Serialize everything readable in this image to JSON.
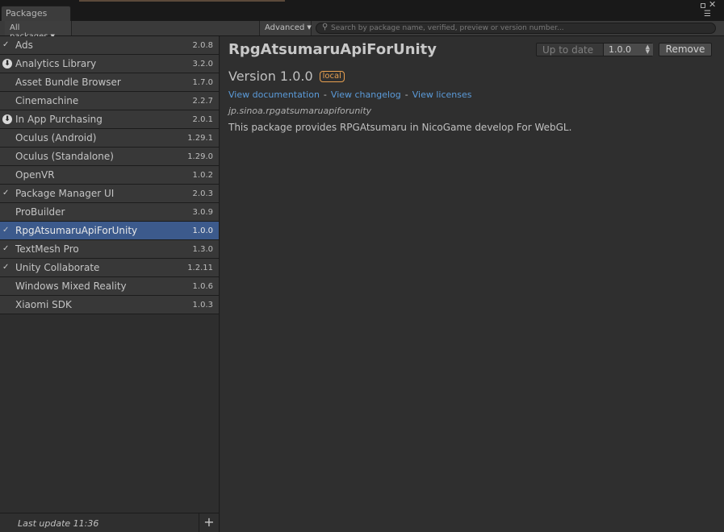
{
  "window": {
    "tab_title": "Packages"
  },
  "toolbar": {
    "filter_label": "All packages",
    "advanced_label": "Advanced",
    "search_placeholder": "Search by package name, verified, preview or version number..."
  },
  "packages": [
    {
      "name": "Ads",
      "version": "2.0.8",
      "status": "check"
    },
    {
      "name": "Analytics Library",
      "version": "3.2.0",
      "status": "download"
    },
    {
      "name": "Asset Bundle Browser",
      "version": "1.7.0",
      "status": ""
    },
    {
      "name": "Cinemachine",
      "version": "2.2.7",
      "status": ""
    },
    {
      "name": "In App Purchasing",
      "version": "2.0.1",
      "status": "download"
    },
    {
      "name": "Oculus (Android)",
      "version": "1.29.1",
      "status": ""
    },
    {
      "name": "Oculus (Standalone)",
      "version": "1.29.0",
      "status": ""
    },
    {
      "name": "OpenVR",
      "version": "1.0.2",
      "status": ""
    },
    {
      "name": "Package Manager UI",
      "version": "2.0.3",
      "status": "check"
    },
    {
      "name": "ProBuilder",
      "version": "3.0.9",
      "status": ""
    },
    {
      "name": "RpgAtsumaruApiForUnity",
      "version": "1.0.0",
      "status": "check",
      "selected": true
    },
    {
      "name": "TextMesh Pro",
      "version": "1.3.0",
      "status": "check"
    },
    {
      "name": "Unity Collaborate",
      "version": "1.2.11",
      "status": "check"
    },
    {
      "name": "Windows Mixed Reality",
      "version": "1.0.6",
      "status": ""
    },
    {
      "name": "Xiaomi SDK",
      "version": "1.0.3",
      "status": ""
    }
  ],
  "footer": {
    "last_update": "Last update 11:36",
    "add_label": "+"
  },
  "detail": {
    "title": "RpgAtsumaruApiForUnity",
    "status": "Up to date",
    "selected_version": "1.0.0",
    "remove_label": "Remove",
    "version_text": "Version 1.0.0",
    "badge": "local",
    "link_docs": "View documentation",
    "link_changelog": "View changelog",
    "link_licenses": "View licenses",
    "link_separator": "-",
    "package_id": "jp.sinoa.rpgatsumaruapiforunity",
    "description": "This package provides RPGAtsumaru in NicoGame develop For WebGL."
  },
  "icons": {
    "check": "✓",
    "download": "⬇"
  },
  "colors": {
    "selection": "#3c5a8c",
    "link": "#5b9bd9",
    "badge": "#e8a050"
  }
}
